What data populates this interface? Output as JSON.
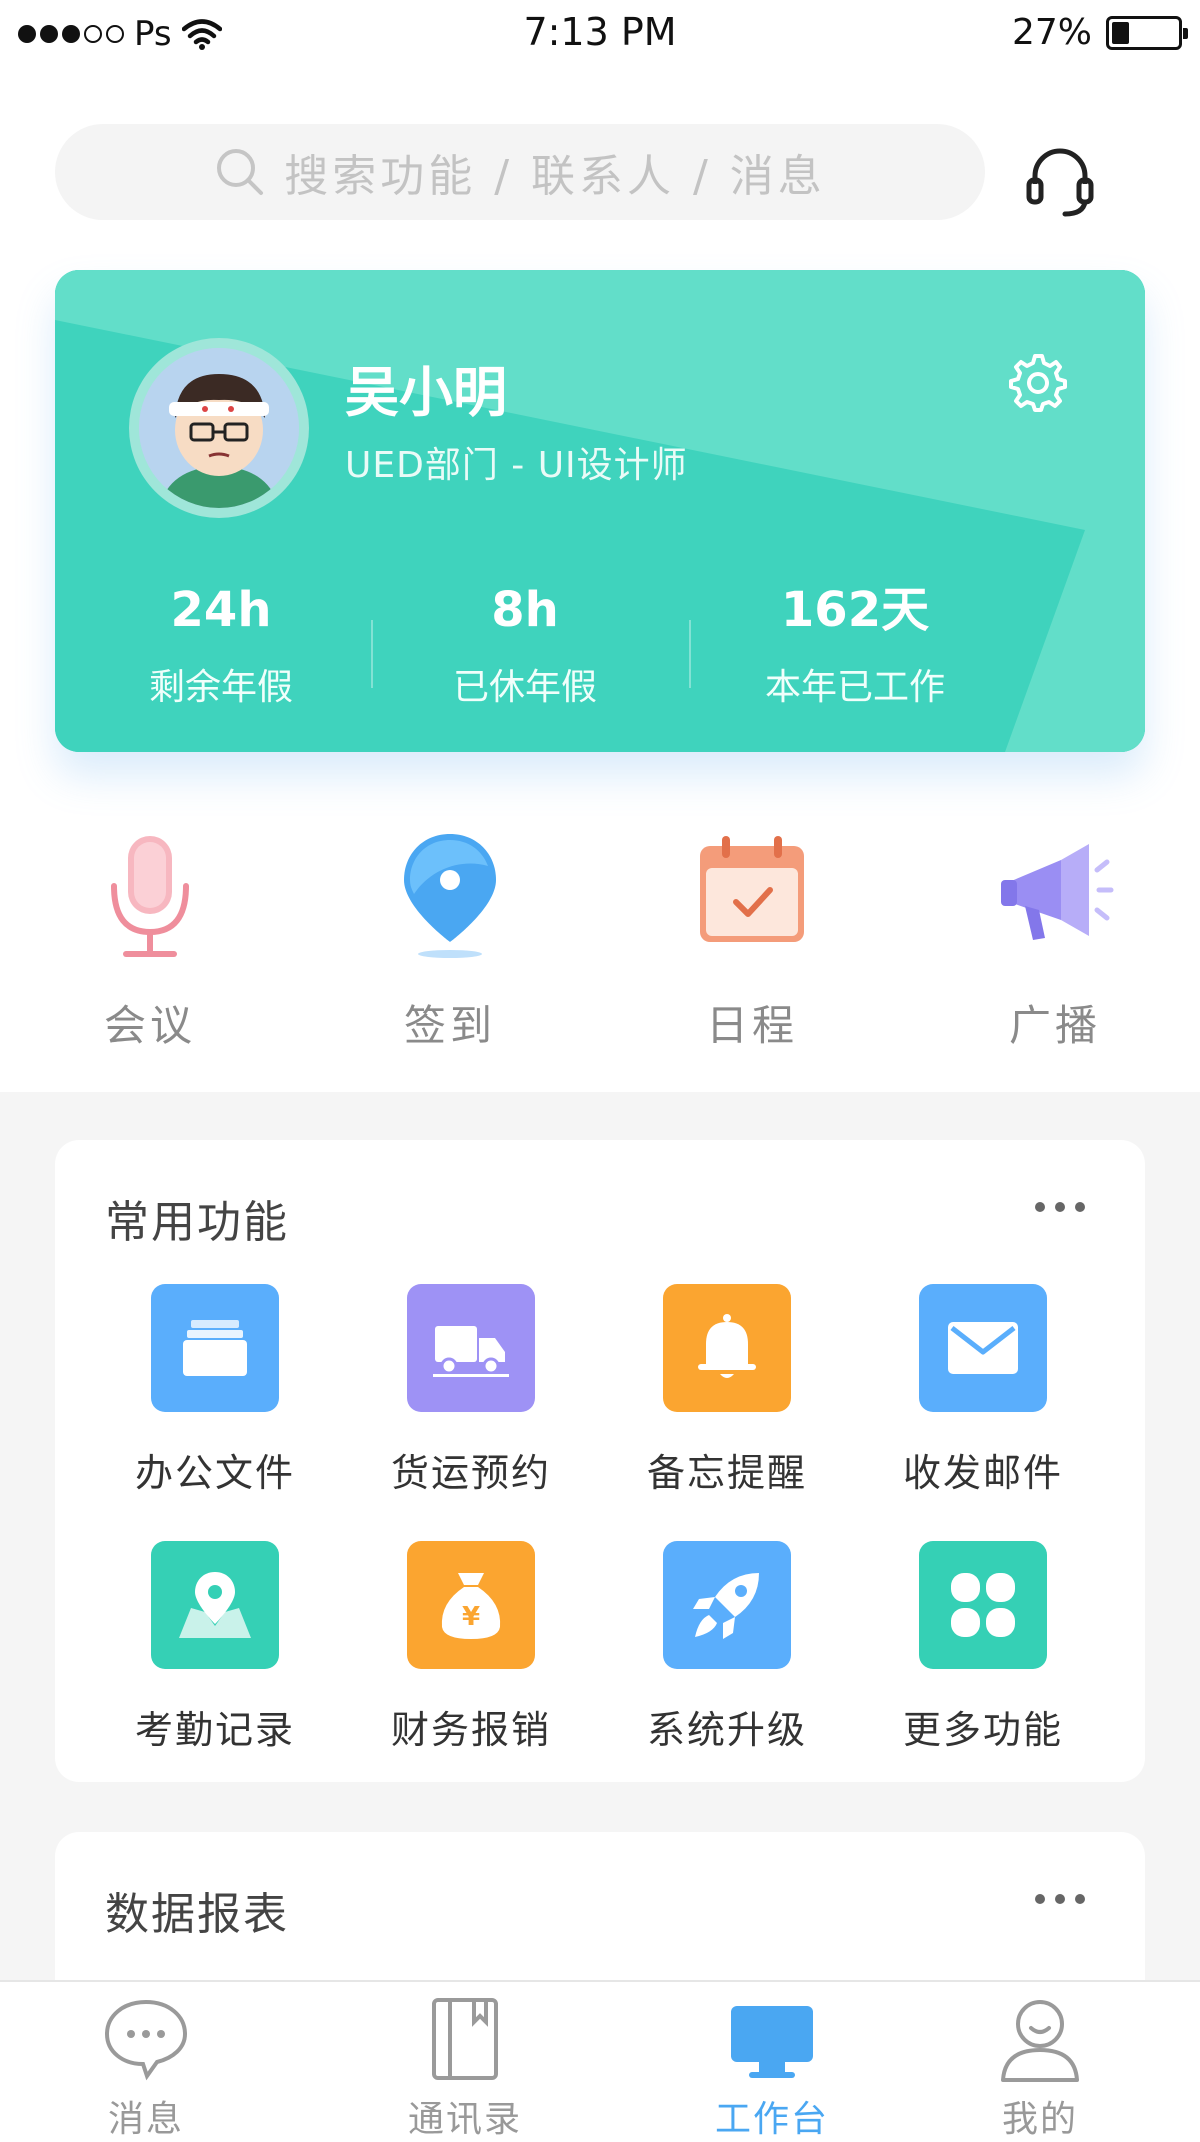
{
  "status_bar": {
    "carrier": "Ps",
    "time": "7:13 PM",
    "battery_percent_text": "27%",
    "battery_level": 0.27
  },
  "search": {
    "placeholder": "搜索功能 / 联系人 / 消息"
  },
  "profile": {
    "name": "吴小明",
    "department": "UED部门 - UI设计师",
    "stats": [
      {
        "value": "24h",
        "label": "剩余年假"
      },
      {
        "value": "8h",
        "label": "已休年假"
      },
      {
        "value": "162天",
        "label": "本年已工作"
      }
    ]
  },
  "quick_actions": [
    {
      "label": "会议",
      "icon": "microphone-icon"
    },
    {
      "label": "签到",
      "icon": "location-pin-icon"
    },
    {
      "label": "日程",
      "icon": "calendar-icon"
    },
    {
      "label": "广播",
      "icon": "megaphone-icon"
    }
  ],
  "common_functions": {
    "title": "常用功能",
    "items": [
      {
        "label": "办公文件",
        "icon": "files-icon",
        "color": "#5aaefc"
      },
      {
        "label": "货运预约",
        "icon": "truck-icon",
        "color": "#9e92f5"
      },
      {
        "label": "备忘提醒",
        "icon": "bell-icon",
        "color": "#fba530"
      },
      {
        "label": "收发邮件",
        "icon": "mail-icon",
        "color": "#5aaefc"
      },
      {
        "label": "考勤记录",
        "icon": "map-pin-icon",
        "color": "#35d0b5"
      },
      {
        "label": "财务报销",
        "icon": "money-bag-icon",
        "color": "#fba530"
      },
      {
        "label": "系统升级",
        "icon": "rocket-icon",
        "color": "#5aaefc"
      },
      {
        "label": "更多功能",
        "icon": "grid-icon",
        "color": "#35d0b5"
      }
    ]
  },
  "data_report": {
    "title": "数据报表"
  },
  "tab_bar": {
    "tabs": [
      {
        "label": "消息",
        "icon": "chat-bubble-icon",
        "active": false
      },
      {
        "label": "通讯录",
        "icon": "contacts-book-icon",
        "active": false
      },
      {
        "label": "工作台",
        "icon": "desktop-icon",
        "active": true
      },
      {
        "label": "我的",
        "icon": "user-icon",
        "active": false
      }
    ]
  },
  "colors": {
    "card_primary": "#3fd3bd",
    "accent_blue": "#4aa7f2",
    "inactive_text": "#999999"
  }
}
